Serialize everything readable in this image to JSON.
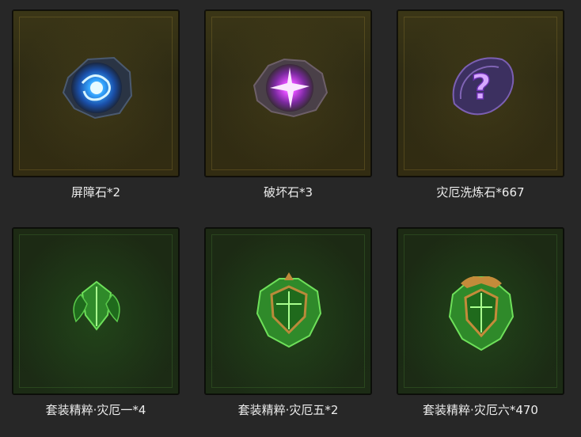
{
  "items": [
    {
      "label": "屏障石*2",
      "icon": "blue-barrier-stone-icon"
    },
    {
      "label": "破坏石*3",
      "icon": "purple-destruction-stone-icon"
    },
    {
      "label": "灾厄洗炼石*667",
      "icon": "purple-question-stone-icon"
    },
    {
      "label": "套装精粹·灾厄一*4",
      "icon": "green-essence-tier1-icon"
    },
    {
      "label": "套装精粹·灾厄五*2",
      "icon": "green-essence-tier5-icon"
    },
    {
      "label": "套装精粹·灾厄六*470",
      "icon": "green-essence-tier6-icon"
    }
  ],
  "colors": {
    "gold_slot": "#332f14",
    "green_slot": "#1c2a14",
    "label_text": "#ececec",
    "background": "#272727"
  }
}
